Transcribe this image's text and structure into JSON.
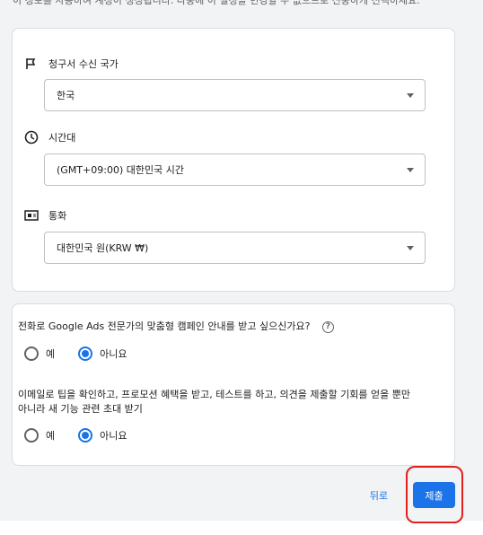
{
  "top_text": "이 정보를 사용하여 계정이 생성됩니다. 나중에 이 설정을 변경할 수 없으므로 신중하게 선택하세요.",
  "billing_country": {
    "label": "청구서 수신 국가",
    "value": "한국",
    "icon": "flag-icon"
  },
  "timezone": {
    "label": "시간대",
    "value": "(GMT+09:00) 대한민국 시간",
    "icon": "clock-icon"
  },
  "currency": {
    "label": "통화",
    "value": "대한민국 원(KRW ₩)",
    "icon": "currency-icon"
  },
  "phone_question": {
    "text": "전화로 Google Ads 전문가의 맞춤형 캠페인 안내를 받고 싶으신가요?",
    "help": "?",
    "yes_label": "예",
    "no_label": "아니요",
    "selected": "no"
  },
  "email_question": {
    "line1": "이메일로 팁을 확인하고, 프로모션 혜택을 받고, 테스트를 하고, 의견을 제출할 기회를 얻을 뿐만",
    "line2": "아니라 새 기능 관련 초대 받기",
    "yes_label": "예",
    "no_label": "아니요",
    "selected": "no"
  },
  "actions": {
    "back_label": "뒤로",
    "submit_label": "제출"
  },
  "colors": {
    "accent": "#1a73e8",
    "highlight": "#e0201d"
  }
}
